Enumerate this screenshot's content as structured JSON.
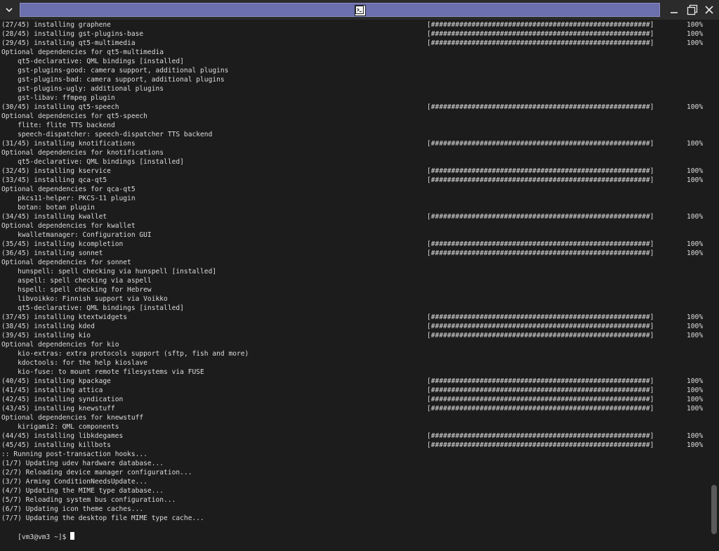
{
  "window": {
    "menu_icon": "chevron-down-icon",
    "title_icon": "terminal-icon",
    "minimize_icon": "minimize-icon",
    "maximize_icon": "maximize-icon",
    "close_icon": "close-icon",
    "accent_color": "#6b6fac"
  },
  "terminal": {
    "prompt": "[vm3@vm3 ~]$ ",
    "lines": [
      {
        "text": "(27/45) installing graphene",
        "bar": true
      },
      {
        "text": "(28/45) installing gst-plugins-base",
        "bar": true
      },
      {
        "text": "(29/45) installing qt5-multimedia",
        "bar": true
      },
      {
        "text": "Optional dependencies for qt5-multimedia"
      },
      {
        "text": "    qt5-declarative: QML bindings [installed]"
      },
      {
        "text": "    gst-plugins-good: camera support, additional plugins"
      },
      {
        "text": "    gst-plugins-bad: camera support, additional plugins"
      },
      {
        "text": "    gst-plugins-ugly: additional plugins"
      },
      {
        "text": "    gst-libav: ffmpeg plugin"
      },
      {
        "text": "(30/45) installing qt5-speech",
        "bar": true
      },
      {
        "text": "Optional dependencies for qt5-speech"
      },
      {
        "text": "    flite: flite TTS backend"
      },
      {
        "text": "    speech-dispatcher: speech-dispatcher TTS backend"
      },
      {
        "text": "(31/45) installing knotifications",
        "bar": true
      },
      {
        "text": "Optional dependencies for knotifications"
      },
      {
        "text": "    qt5-declarative: QML bindings [installed]"
      },
      {
        "text": "(32/45) installing kservice",
        "bar": true
      },
      {
        "text": "(33/45) installing qca-qt5",
        "bar": true
      },
      {
        "text": "Optional dependencies for qca-qt5"
      },
      {
        "text": "    pkcs11-helper: PKCS-11 plugin"
      },
      {
        "text": "    botan: botan plugin"
      },
      {
        "text": "(34/45) installing kwallet",
        "bar": true
      },
      {
        "text": "Optional dependencies for kwallet"
      },
      {
        "text": "    kwalletmanager: Configuration GUI"
      },
      {
        "text": "(35/45) installing kcompletion",
        "bar": true
      },
      {
        "text": "(36/45) installing sonnet",
        "bar": true
      },
      {
        "text": "Optional dependencies for sonnet"
      },
      {
        "text": "    hunspell: spell checking via hunspell [installed]"
      },
      {
        "text": "    aspell: spell checking via aspell"
      },
      {
        "text": "    hspell: spell checking for Hebrew"
      },
      {
        "text": "    libvoikko: Finnish support via Voikko"
      },
      {
        "text": "    qt5-declarative: QML bindings [installed]"
      },
      {
        "text": "(37/45) installing ktextwidgets",
        "bar": true
      },
      {
        "text": "(38/45) installing kded",
        "bar": true
      },
      {
        "text": "(39/45) installing kio",
        "bar": true
      },
      {
        "text": "Optional dependencies for kio"
      },
      {
        "text": "    kio-extras: extra protocols support (sftp, fish and more)"
      },
      {
        "text": "    kdoctools: for the help kioslave"
      },
      {
        "text": "    kio-fuse: to mount remote filesystems via FUSE"
      },
      {
        "text": "(40/45) installing kpackage",
        "bar": true
      },
      {
        "text": "(41/45) installing attica",
        "bar": true
      },
      {
        "text": "(42/45) installing syndication",
        "bar": true
      },
      {
        "text": "(43/45) installing knewstuff",
        "bar": true
      },
      {
        "text": "Optional dependencies for knewstuff"
      },
      {
        "text": "    kirigami2: QML components"
      },
      {
        "text": "(44/45) installing libkdegames",
        "bar": true
      },
      {
        "text": "(45/45) installing killbots",
        "bar": true
      },
      {
        "text": ":: Running post-transaction hooks..."
      },
      {
        "text": "(1/7) Updating udev hardware database..."
      },
      {
        "text": "(2/7) Reloading device manager configuration..."
      },
      {
        "text": "(3/7) Arming ConditionNeedsUpdate..."
      },
      {
        "text": "(4/7) Updating the MIME type database..."
      },
      {
        "text": "(5/7) Reloading system bus configuration..."
      },
      {
        "text": "(6/7) Updating icon theme caches..."
      },
      {
        "text": "(7/7) Updating the desktop file MIME type cache..."
      }
    ],
    "progress_bar_text": "[######################################################]",
    "progress_percent": "100%"
  }
}
